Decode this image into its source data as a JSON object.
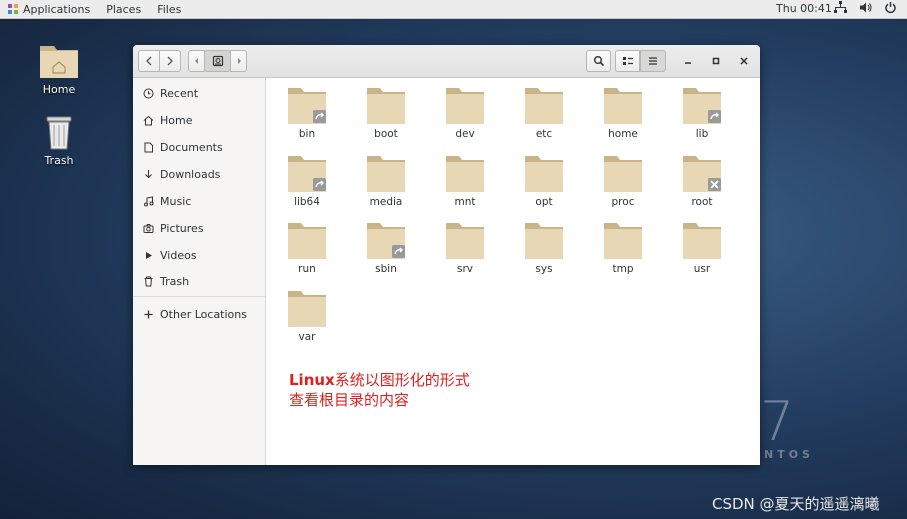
{
  "topbar": {
    "applications": "Applications",
    "places": "Places",
    "files": "Files",
    "clock": "Thu 00:41",
    "tray_icons": [
      "network-icon",
      "volume-icon",
      "power-icon"
    ]
  },
  "desktop": {
    "icons": [
      {
        "label": "Home",
        "icon": "home-folder-icon"
      },
      {
        "label": "Trash",
        "icon": "trash-icon"
      }
    ],
    "brand_number": "7",
    "brand_text": "NTOS",
    "watermark": "CSDN @夏天的遥遥漓曦"
  },
  "window": {
    "toolbar": {
      "back": "back-icon",
      "forward": "forward-icon",
      "path_left": "path-left-icon",
      "path_root": "drive-icon",
      "path_right": "path-right-icon",
      "search": "search-icon",
      "view_list": "list-view-icon",
      "menu": "hamburger-icon"
    },
    "controls": [
      "minimize-icon",
      "maximize-icon",
      "close-icon"
    ],
    "sidebar": {
      "items": [
        {
          "label": "Recent",
          "icon": "clock-icon"
        },
        {
          "label": "Home",
          "icon": "home-icon"
        },
        {
          "label": "Documents",
          "icon": "document-icon"
        },
        {
          "label": "Downloads",
          "icon": "download-icon"
        },
        {
          "label": "Music",
          "icon": "music-icon"
        },
        {
          "label": "Pictures",
          "icon": "camera-icon"
        },
        {
          "label": "Videos",
          "icon": "video-icon"
        },
        {
          "label": "Trash",
          "icon": "trash-icon"
        }
      ],
      "other_locations": "Other Locations"
    },
    "folders": [
      {
        "name": "bin",
        "badge": "link"
      },
      {
        "name": "boot",
        "badge": ""
      },
      {
        "name": "dev",
        "badge": ""
      },
      {
        "name": "etc",
        "badge": ""
      },
      {
        "name": "home",
        "badge": ""
      },
      {
        "name": "lib",
        "badge": "link"
      },
      {
        "name": "lib64",
        "badge": "link"
      },
      {
        "name": "media",
        "badge": ""
      },
      {
        "name": "mnt",
        "badge": ""
      },
      {
        "name": "opt",
        "badge": ""
      },
      {
        "name": "proc",
        "badge": ""
      },
      {
        "name": "root",
        "badge": "locked"
      },
      {
        "name": "run",
        "badge": ""
      },
      {
        "name": "sbin",
        "badge": "link"
      },
      {
        "name": "srv",
        "badge": ""
      },
      {
        "name": "sys",
        "badge": ""
      },
      {
        "name": "tmp",
        "badge": ""
      },
      {
        "name": "usr",
        "badge": ""
      },
      {
        "name": "var",
        "badge": ""
      }
    ],
    "annotation": {
      "line1_bold": "Linux",
      "line1_rest": "系统以图形化的形式",
      "line2": "查看根目录的内容"
    }
  },
  "colors": {
    "folder_body": "#e7d7b5",
    "folder_tab": "#c9b48a",
    "annotation": "#e02020"
  }
}
